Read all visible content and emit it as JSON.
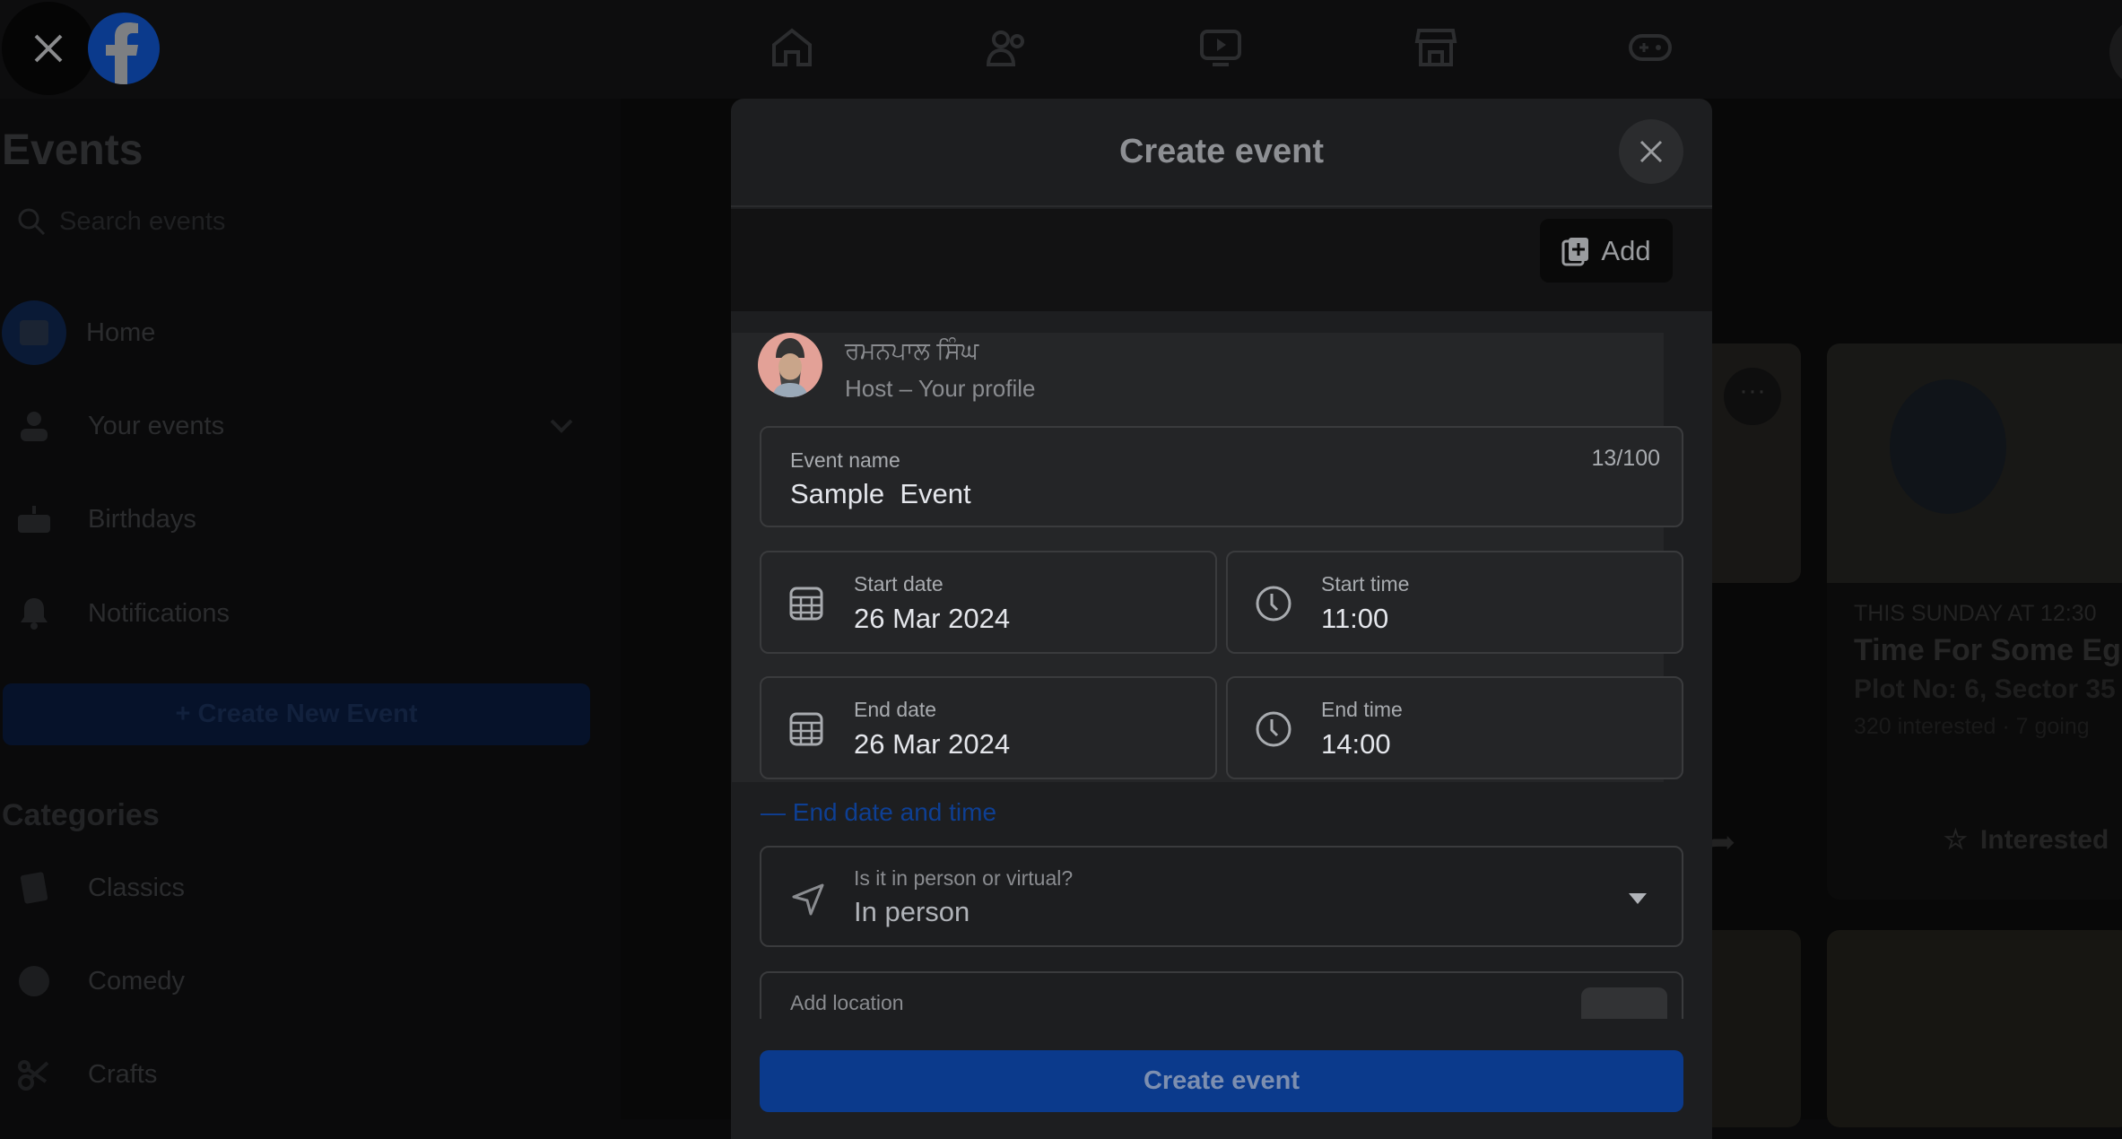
{
  "topbar": {
    "close_icon": "close-icon",
    "logo": "facebook-logo",
    "nav_icons": [
      "home-icon",
      "friends-icon",
      "video-icon",
      "marketplace-icon",
      "gaming-icon"
    ]
  },
  "sidebar": {
    "title": "Events",
    "search_placeholder": "Search events",
    "items": [
      {
        "label": "Home",
        "icon": "calendar-icon"
      },
      {
        "label": "Your events",
        "icon": "person-icon"
      },
      {
        "label": "Birthdays",
        "icon": "cake-icon"
      },
      {
        "label": "Notifications",
        "icon": "bell-icon"
      }
    ],
    "create_button": "+ Create New Event",
    "categories_title": "Categories",
    "categories": [
      {
        "label": "Classics",
        "icon": "book-icon"
      },
      {
        "label": "Comedy",
        "icon": "laugh-icon"
      },
      {
        "label": "Crafts",
        "icon": "scissors-icon"
      }
    ]
  },
  "feed": {
    "card": {
      "date": "THIS SUNDAY AT 12:30",
      "title": "Time For Some Egg",
      "location": "Plot No: 6, Sector 35",
      "stats": "320 interested · 7 going",
      "interested_label": "Interested"
    }
  },
  "modal": {
    "title": "Create event",
    "add_label": "Add",
    "host": {
      "name": "ਰਮਨਪਾਲ ਸਿੰਘ",
      "role": "Host – Your profile"
    },
    "event_name": {
      "label": "Event name",
      "value": "Sample  Event",
      "counter": "13/100"
    },
    "start_date": {
      "label": "Start date",
      "value": "26 Mar 2024"
    },
    "start_time": {
      "label": "Start time",
      "value": "11:00"
    },
    "end_date": {
      "label": "End date",
      "value": "26 Mar 2024"
    },
    "end_time": {
      "label": "End time",
      "value": "14:00"
    },
    "toggle_end": "— End date and time",
    "location_type": {
      "label": "Is it in person or virtual?",
      "value": "In person"
    },
    "location": {
      "placeholder": "Add location"
    },
    "submit": "Create event"
  },
  "colors": {
    "accent": "#0b3a8c",
    "link": "#0e3f93",
    "modal_bg": "#1d1e20"
  }
}
